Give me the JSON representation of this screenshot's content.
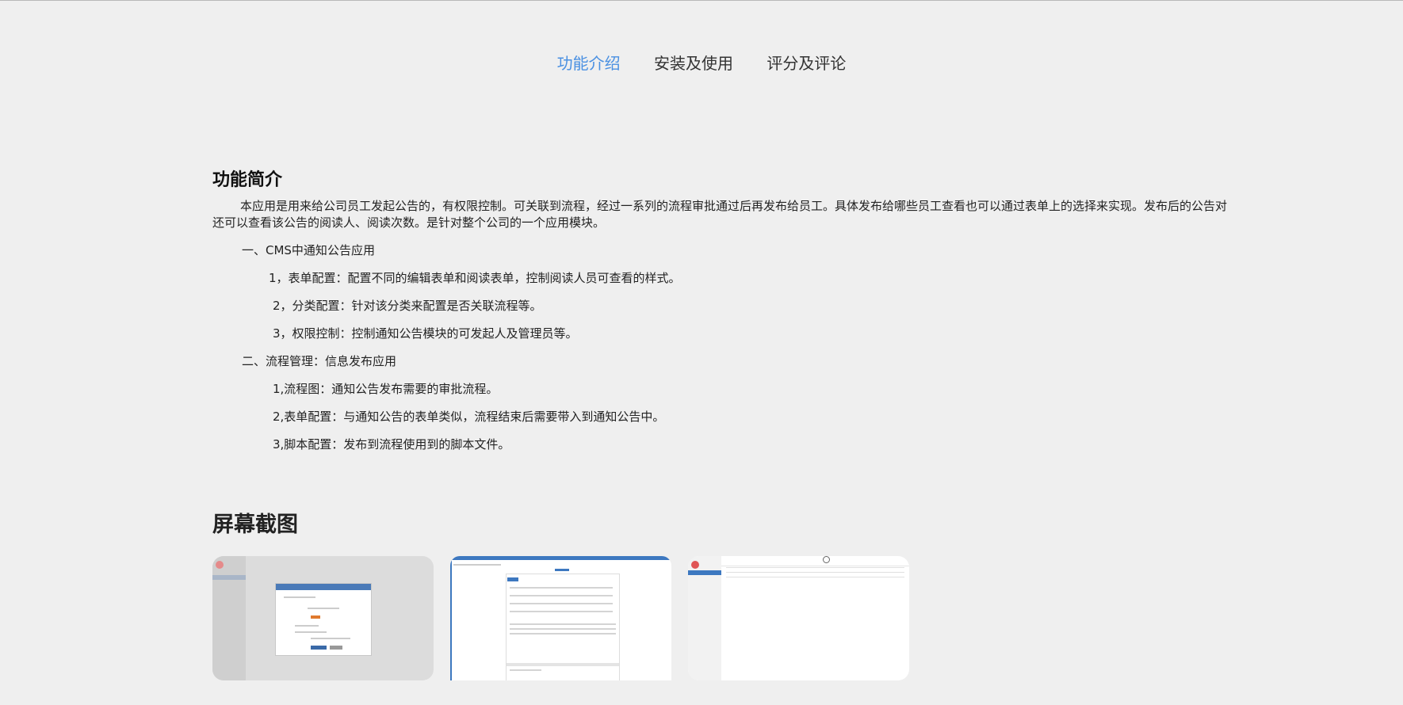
{
  "nav": {
    "tabs": [
      {
        "label": "功能介绍",
        "active": true
      },
      {
        "label": "安装及使用",
        "active": false
      },
      {
        "label": "评分及评论",
        "active": false
      }
    ]
  },
  "intro_section": {
    "title": "功能简介",
    "paragraph": "本应用是用来给公司员工发起公告的，有权限控制。可关联到流程，经过一系列的流程审批通过后再发布给员工。具体发布给哪些员工查看也可以通过表单上的选择来实现。发布后的公告对还可以查看该公告的阅读人、阅读次数。是针对整个公司的一个应用模块。",
    "items": [
      "一、CMS中通知公告应用",
      "1，表单配置：配置不同的编辑表单和阅读表单，控制阅读人员可查看的样式。",
      "2，分类配置：针对该分类来配置是否关联流程等。",
      "3，权限控制：控制通知公告模块的可发起人及管理员等。",
      "二、流程管理：信息发布应用",
      "1,流程图：通知公告发布需要的审批流程。",
      "2,表单配置：与通知公告的表单类似，流程结束后需要带入到通知公告中。",
      "3,脚本配置：发布到流程使用到的脚本文件。"
    ]
  },
  "screenshots_section": {
    "title": "屏幕截图"
  },
  "colors": {
    "background": "#efefef",
    "accent": "#4a90e2",
    "text": "#222222"
  }
}
